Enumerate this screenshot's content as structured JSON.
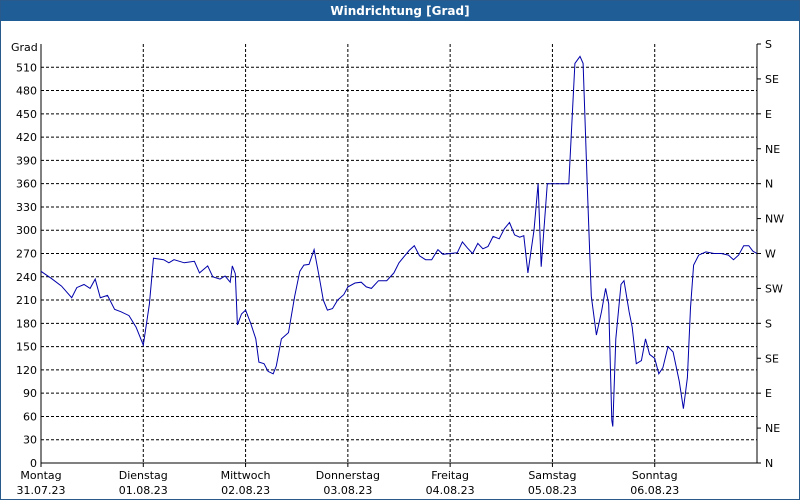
{
  "window": {
    "title": "Windrichtung [Grad]"
  },
  "colors": {
    "titlebar": "#1f5d96",
    "line": "#0000aa",
    "grid": "#000000"
  },
  "chart_data": {
    "type": "line",
    "title": "Windrichtung [Grad]",
    "ylabel": "Grad",
    "ylim": [
      0,
      540
    ],
    "yticks": [
      0,
      30,
      60,
      90,
      120,
      150,
      180,
      210,
      240,
      270,
      300,
      330,
      360,
      390,
      420,
      450,
      480,
      510
    ],
    "right_axis": [
      {
        "value": 0,
        "label": "N"
      },
      {
        "value": 45,
        "label": "NE"
      },
      {
        "value": 90,
        "label": "E"
      },
      {
        "value": 135,
        "label": "SE"
      },
      {
        "value": 180,
        "label": "S"
      },
      {
        "value": 225,
        "label": "SW"
      },
      {
        "value": 270,
        "label": "W"
      },
      {
        "value": 315,
        "label": "NW"
      },
      {
        "value": 360,
        "label": "N"
      },
      {
        "value": 405,
        "label": "NE"
      },
      {
        "value": 450,
        "label": "E"
      },
      {
        "value": 495,
        "label": "SE"
      },
      {
        "value": 540,
        "label": "S"
      }
    ],
    "xlim": [
      0,
      7
    ],
    "x_unit": "days from 31.07.23 00:00",
    "xticks": [
      {
        "x": 0,
        "day": "Montag",
        "date": "31.07.23"
      },
      {
        "x": 1,
        "day": "Dienstag",
        "date": "01.08.23"
      },
      {
        "x": 2,
        "day": "Mittwoch",
        "date": "02.08.23"
      },
      {
        "x": 3,
        "day": "Donnerstag",
        "date": "03.08.23"
      },
      {
        "x": 4,
        "day": "Freitag",
        "date": "04.08.23"
      },
      {
        "x": 5,
        "day": "Samstag",
        "date": "05.08.23"
      },
      {
        "x": 6,
        "day": "Sonntag",
        "date": "06.08.23"
      }
    ],
    "grid": true,
    "series": [
      {
        "points": [
          [
            0.0,
            247
          ],
          [
            0.1,
            238
          ],
          [
            0.2,
            228
          ],
          [
            0.3,
            213
          ],
          [
            0.35,
            226
          ],
          [
            0.42,
            230
          ],
          [
            0.48,
            225
          ],
          [
            0.53,
            237
          ],
          [
            0.58,
            213
          ],
          [
            0.65,
            216
          ],
          [
            0.72,
            198
          ],
          [
            0.78,
            195
          ],
          [
            0.86,
            190
          ],
          [
            0.93,
            175
          ],
          [
            1.0,
            152
          ],
          [
            1.06,
            205
          ],
          [
            1.1,
            264
          ],
          [
            1.2,
            262
          ],
          [
            1.25,
            258
          ],
          [
            1.3,
            262
          ],
          [
            1.4,
            258
          ],
          [
            1.5,
            260
          ],
          [
            1.55,
            245
          ],
          [
            1.63,
            254
          ],
          [
            1.68,
            240
          ],
          [
            1.75,
            237
          ],
          [
            1.8,
            241
          ],
          [
            1.85,
            233
          ],
          [
            1.87,
            254
          ],
          [
            1.9,
            244
          ],
          [
            1.92,
            178
          ],
          [
            1.96,
            192
          ],
          [
            2.0,
            197
          ],
          [
            2.05,
            180
          ],
          [
            2.1,
            160
          ],
          [
            2.13,
            130
          ],
          [
            2.18,
            128
          ],
          [
            2.22,
            118
          ],
          [
            2.27,
            115
          ],
          [
            2.3,
            125
          ],
          [
            2.35,
            160
          ],
          [
            2.42,
            168
          ],
          [
            2.48,
            215
          ],
          [
            2.53,
            247
          ],
          [
            2.57,
            255
          ],
          [
            2.62,
            256
          ],
          [
            2.67,
            275
          ],
          [
            2.72,
            240
          ],
          [
            2.76,
            210
          ],
          [
            2.8,
            197
          ],
          [
            2.85,
            199
          ],
          [
            2.9,
            210
          ],
          [
            2.96,
            217
          ],
          [
            3.0,
            227
          ],
          [
            3.07,
            232
          ],
          [
            3.13,
            233
          ],
          [
            3.18,
            227
          ],
          [
            3.23,
            225
          ],
          [
            3.3,
            235
          ],
          [
            3.38,
            235
          ],
          [
            3.45,
            245
          ],
          [
            3.5,
            258
          ],
          [
            3.55,
            266
          ],
          [
            3.6,
            274
          ],
          [
            3.65,
            280
          ],
          [
            3.7,
            267
          ],
          [
            3.76,
            262
          ],
          [
            3.82,
            262
          ],
          [
            3.88,
            275
          ],
          [
            3.93,
            269
          ],
          [
            4.0,
            270
          ],
          [
            4.07,
            271
          ],
          [
            4.12,
            285
          ],
          [
            4.17,
            277
          ],
          [
            4.22,
            270
          ],
          [
            4.27,
            283
          ],
          [
            4.32,
            276
          ],
          [
            4.37,
            279
          ],
          [
            4.42,
            292
          ],
          [
            4.48,
            289
          ],
          [
            4.53,
            302
          ],
          [
            4.58,
            310
          ],
          [
            4.63,
            294
          ],
          [
            4.68,
            291
          ],
          [
            4.72,
            293
          ],
          [
            4.76,
            245
          ],
          [
            4.82,
            300
          ],
          [
            4.86,
            360
          ],
          [
            4.89,
            253
          ],
          [
            4.95,
            360
          ],
          [
            5.02,
            360
          ],
          [
            5.1,
            360
          ],
          [
            5.16,
            360
          ],
          [
            5.22,
            515
          ],
          [
            5.27,
            524
          ],
          [
            5.3,
            515
          ],
          [
            5.34,
            360
          ],
          [
            5.38,
            215
          ],
          [
            5.43,
            165
          ],
          [
            5.48,
            195
          ],
          [
            5.52,
            225
          ],
          [
            5.55,
            205
          ],
          [
            5.58,
            55
          ],
          [
            5.59,
            47
          ],
          [
            5.62,
            160
          ],
          [
            5.67,
            230
          ],
          [
            5.7,
            235
          ],
          [
            5.75,
            195
          ],
          [
            5.78,
            175
          ],
          [
            5.82,
            128
          ],
          [
            5.87,
            132
          ],
          [
            5.91,
            160
          ],
          [
            5.95,
            140
          ],
          [
            6.0,
            135
          ],
          [
            6.04,
            115
          ],
          [
            6.08,
            123
          ],
          [
            6.13,
            150
          ],
          [
            6.18,
            143
          ],
          [
            6.24,
            105
          ],
          [
            6.28,
            70
          ],
          [
            6.32,
            110
          ],
          [
            6.35,
            200
          ],
          [
            6.38,
            255
          ],
          [
            6.43,
            268
          ],
          [
            6.5,
            272
          ],
          [
            6.58,
            270
          ],
          [
            6.65,
            270
          ],
          [
            6.72,
            268
          ],
          [
            6.77,
            262
          ],
          [
            6.82,
            268
          ],
          [
            6.87,
            280
          ],
          [
            6.92,
            280
          ],
          [
            6.96,
            273
          ],
          [
            7.0,
            270
          ]
        ]
      }
    ]
  }
}
